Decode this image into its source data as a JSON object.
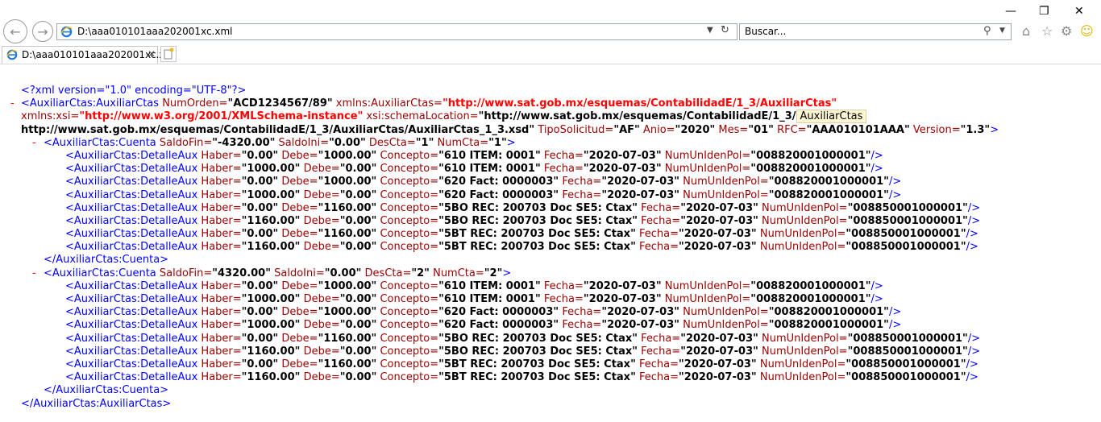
{
  "browser": {
    "address": "D:\\aaa010101aaa202001xc.xml",
    "search_placeholder": "Buscar...",
    "tab_title": "D:\\aaa010101aaa202001xc.x...",
    "tab_close": "✕"
  },
  "icons": {
    "back": "back-arrow-icon",
    "forward": "forward-arrow-icon",
    "home": "home-icon",
    "favorites": "star-icon",
    "settings": "gear-icon",
    "feedback": "smiley-icon"
  },
  "xml": {
    "decl": "<?xml version=\"1.0\" encoding=\"UTF-8\"?>",
    "root_open": "<AuxiliarCtas:AuxiliarCtas",
    "root_close": "</AuxiliarCtas:AuxiliarCtas>",
    "attr": {
      "numorden_n": "NumOrden=",
      "numorden_v": "\"ACD1234567/89\"",
      "xmlns_n": "xmlns:AuxiliarCtas=",
      "xmlns_v": "\"http://www.sat.gob.mx/esquemas/ContabilidadE/1_3/AuxiliarCtas\"",
      "xsi_n": "xmlns:xsi=",
      "xsi_v": "\"http://www.w3.org/2001/XMLSchema-instance\"",
      "schema_n": "xsi:schemaLocation=",
      "schema_v1": "\"http://www.sat.gob.mx/esquemas/ContabilidadE/1_3/",
      "schema_tip": "AuxiliarCtas",
      "schema_v2": "http://www.sat.gob.mx/esquemas/ContabilidadE/1_3/AuxiliarCtas/AuxiliarCtas_1_3.xsd\"",
      "tipo_n": "TipoSolicitud=",
      "tipo_v": "\"AF\"",
      "anio_n": "Anio=",
      "anio_v": "\"2020\"",
      "mes_n": "Mes=",
      "mes_v": "\"01\"",
      "rfc_n": "RFC=",
      "rfc_v": "\"AAA010101AAA\"",
      "ver_n": "Version=",
      "ver_v": "\"1.3\"",
      "gt": ">"
    },
    "cuentas": [
      {
        "open": "<AuxiliarCtas:Cuenta",
        "saldofin_n": "SaldoFin=",
        "saldofin_v": "\"-4320.00\"",
        "saldoini_n": "SaldoIni=",
        "saldoini_v": "\"0.00\"",
        "descta_n": "DesCta=",
        "descta_v": "\"1\"",
        "numcta_n": "NumCta=",
        "numcta_v": "\"1\"",
        "gt": ">",
        "close": "</AuxiliarCtas:Cuenta>",
        "detalles": [
          {
            "haber": "\"0.00\"",
            "debe": "\"1000.00\"",
            "concepto": "\"610 ITEM: 0001\"",
            "fecha": "\"2020-07-03\"",
            "num": "\"008820001000001\""
          },
          {
            "haber": "\"1000.00\"",
            "debe": "\"0.00\"",
            "concepto": "\"610 ITEM: 0001\"",
            "fecha": "\"2020-07-03\"",
            "num": "\"008820001000001\""
          },
          {
            "haber": "\"0.00\"",
            "debe": "\"1000.00\"",
            "concepto": "\"620 Fact: 0000003\"",
            "fecha": "\"2020-07-03\"",
            "num": "\"008820001000001\""
          },
          {
            "haber": "\"1000.00\"",
            "debe": "\"0.00\"",
            "concepto": "\"620 Fact: 0000003\"",
            "fecha": "\"2020-07-03\"",
            "num": "\"008820001000001\""
          },
          {
            "haber": "\"0.00\"",
            "debe": "\"1160.00\"",
            "concepto": "\"5BO REC: 200703 Doc SE5: Ctax\"",
            "fecha": "\"2020-07-03\"",
            "num": "\"008850001000001\""
          },
          {
            "haber": "\"1160.00\"",
            "debe": "\"0.00\"",
            "concepto": "\"5BO REC: 200703 Doc SE5: Ctax\"",
            "fecha": "\"2020-07-03\"",
            "num": "\"008850001000001\""
          },
          {
            "haber": "\"0.00\"",
            "debe": "\"1160.00\"",
            "concepto": "\"5BT REC: 200703 Doc SE5: Ctax\"",
            "fecha": "\"2020-07-03\"",
            "num": "\"008850001000001\""
          },
          {
            "haber": "\"1160.00\"",
            "debe": "\"0.00\"",
            "concepto": "\"5BT REC: 200703 Doc SE5: Ctax\"",
            "fecha": "\"2020-07-03\"",
            "num": "\"008850001000001\""
          }
        ]
      },
      {
        "open": "<AuxiliarCtas:Cuenta",
        "saldofin_n": "SaldoFin=",
        "saldofin_v": "\"4320.00\"",
        "saldoini_n": "SaldoIni=",
        "saldoini_v": "\"0.00\"",
        "descta_n": "DesCta=",
        "descta_v": "\"2\"",
        "numcta_n": "NumCta=",
        "numcta_v": "\"2\"",
        "gt": ">",
        "close": "</AuxiliarCtas:Cuenta>",
        "detalles": [
          {
            "haber": "\"0.00\"",
            "debe": "\"1000.00\"",
            "concepto": "\"610 ITEM: 0001\"",
            "fecha": "\"2020-07-03\"",
            "num": "\"008820001000001\""
          },
          {
            "haber": "\"1000.00\"",
            "debe": "\"0.00\"",
            "concepto": "\"610 ITEM: 0001\"",
            "fecha": "\"2020-07-03\"",
            "num": "\"008820001000001\""
          },
          {
            "haber": "\"0.00\"",
            "debe": "\"1000.00\"",
            "concepto": "\"620 Fact: 0000003\"",
            "fecha": "\"2020-07-03\"",
            "num": "\"008820001000001\""
          },
          {
            "haber": "\"1000.00\"",
            "debe": "\"0.00\"",
            "concepto": "\"620 Fact: 0000003\"",
            "fecha": "\"2020-07-03\"",
            "num": "\"008820001000001\""
          },
          {
            "haber": "\"0.00\"",
            "debe": "\"1160.00\"",
            "concepto": "\"5BO REC: 200703 Doc SE5: Ctax\"",
            "fecha": "\"2020-07-03\"",
            "num": "\"008850001000001\""
          },
          {
            "haber": "\"1160.00\"",
            "debe": "\"0.00\"",
            "concepto": "\"5BO REC: 200703 Doc SE5: Ctax\"",
            "fecha": "\"2020-07-03\"",
            "num": "\"008850001000001\""
          },
          {
            "haber": "\"0.00\"",
            "debe": "\"1160.00\"",
            "concepto": "\"5BT REC: 200703 Doc SE5: Ctax\"",
            "fecha": "\"2020-07-03\"",
            "num": "\"008850001000001\""
          },
          {
            "haber": "\"1160.00\"",
            "debe": "\"0.00\"",
            "concepto": "\"5BT REC: 200703 Doc SE5: Ctax\"",
            "fecha": "\"2020-07-03\"",
            "num": "\"008850001000001\""
          }
        ]
      }
    ],
    "detalle": {
      "open": "<AuxiliarCtas:DetalleAux",
      "haber_n": "Haber=",
      "debe_n": "Debe=",
      "concepto_n": "Concepto=",
      "fecha_n": "Fecha=",
      "num_n": "NumUnIdenPol=",
      "selfclose": "/>"
    }
  }
}
